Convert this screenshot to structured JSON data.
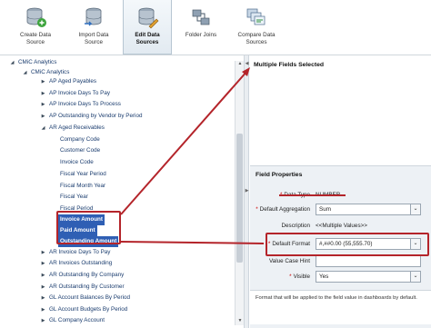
{
  "toolbar": {
    "buttons": [
      {
        "label": "Create Data\nSource",
        "icon": "database-add-icon",
        "active": false
      },
      {
        "label": "Import Data\nSource",
        "icon": "database-import-icon",
        "active": false
      },
      {
        "label": "Edit Data\nSources",
        "icon": "database-edit-icon",
        "active": true
      },
      {
        "label": "Folder Joins",
        "icon": "folder-joins-icon",
        "active": false
      },
      {
        "label": "Compare Data\nSources",
        "icon": "compare-icon",
        "active": false
      }
    ]
  },
  "tree": {
    "items": [
      {
        "label": "CMiC Analytics",
        "level": 0,
        "expanded": true
      },
      {
        "label": "CMiC Analytics",
        "level": 1,
        "expanded": true
      },
      {
        "label": "AP Aged Payables",
        "level": 2,
        "expanded": false
      },
      {
        "label": "AP Invoice Days To Pay",
        "level": 2,
        "expanded": false
      },
      {
        "label": "AP Invoice Days To Process",
        "level": 2,
        "expanded": false
      },
      {
        "label": "AP Outstanding by Vendor by Period",
        "level": 2,
        "expanded": false
      },
      {
        "label": "AR Aged Receivables",
        "level": 2,
        "expanded": true
      },
      {
        "label": "Company Code",
        "level": 3,
        "leaf": true
      },
      {
        "label": "Customer Code",
        "level": 3,
        "leaf": true
      },
      {
        "label": "Invoice Code",
        "level": 3,
        "leaf": true
      },
      {
        "label": "Fiscal Year Period",
        "level": 3,
        "leaf": true
      },
      {
        "label": "Fiscal Month Year",
        "level": 3,
        "leaf": true
      },
      {
        "label": "Fiscal Year",
        "level": 3,
        "leaf": true
      },
      {
        "label": "Fiscal Period",
        "level": 3,
        "leaf": true
      },
      {
        "label": "Invoice Amount",
        "level": 3,
        "leaf": true,
        "selected": true
      },
      {
        "label": "Paid Amount",
        "level": 3,
        "leaf": true,
        "selected": true
      },
      {
        "label": "Outstanding Amount",
        "level": 3,
        "leaf": true,
        "selected": true
      },
      {
        "label": "AR Invoice Days To Pay",
        "level": 2,
        "expanded": false
      },
      {
        "label": "AR Invoices Outstanding",
        "level": 2,
        "expanded": false
      },
      {
        "label": "AR Outstanding By Company",
        "level": 2,
        "expanded": false
      },
      {
        "label": "AR Outstanding By Customer",
        "level": 2,
        "expanded": false
      },
      {
        "label": "GL Account Balances By Period",
        "level": 2,
        "expanded": false
      },
      {
        "label": "GL Account Budgets By Period",
        "level": 2,
        "expanded": false
      },
      {
        "label": "GL Company Account",
        "level": 2,
        "expanded": false
      }
    ]
  },
  "right": {
    "title": "Multiple Fields Selected",
    "field_properties": {
      "title": "Field Properties",
      "data_type_label": "Data Type",
      "data_type_value": "NUMBER",
      "default_aggregation_label": "Default Aggregation",
      "default_aggregation_value": "Sum",
      "description_label": "Description",
      "description_value": "<<Multiple Values>>",
      "default_format_label": "Default Format",
      "default_format_value": "#,##0.00 (55,555.70)",
      "value_case_hint_label": "Value Case Hint",
      "visible_label": "Visible",
      "visible_value": "Yes",
      "hint_text": "Format that will be applied to the field value in dashboards by default."
    }
  },
  "colors": {
    "accent": "#2f5fb4",
    "annotation": "#b4242a"
  }
}
